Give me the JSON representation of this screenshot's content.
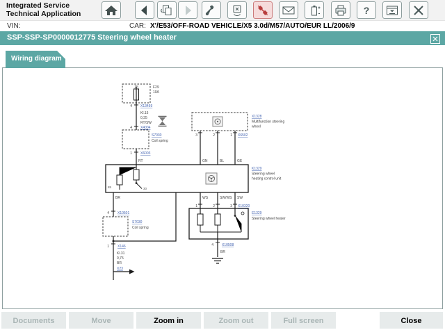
{
  "app": {
    "brand_line1": "Integrated Service",
    "brand_line2": "Technical Application"
  },
  "toolbar": {
    "icons": [
      "home",
      "back",
      "copy-session",
      "forward",
      "wrench",
      "measuring-device",
      "connector-alert",
      "mail",
      "battery",
      "print",
      "help",
      "minimize-tray",
      "close"
    ],
    "help_glyph": "?"
  },
  "vehicle": {
    "vin_label": "VIN:",
    "car_label": "CAR:",
    "car_value": "X'/E53/OFF-ROAD VEHICLE/X5 3.0d/M57/AUTO/EUR LL/2006/9"
  },
  "title_bar": {
    "title": "SSP-SSP-SP0000012775 Steering wheel heater"
  },
  "tabs": {
    "wiring": "Wiring diagram"
  },
  "diagram": {
    "fuse_pin_top": "16",
    "fuse_name": "F29",
    "fuse_rating": "10A",
    "conn1_pin": "4",
    "conn1_link": "X13459",
    "wire1_l1": "Kl.15",
    "wire1_l2": "0,35",
    "wire1_l3": "RT/SW",
    "conn2_pin": "4",
    "conn2_link": "X4004",
    "coil1_link": "S7030",
    "coil1_name": "Coil spring",
    "conn3_pin": "1",
    "conn3_link": "X6003",
    "wire2_color": "RT",
    "mfsw_link": "X1328",
    "mfsw_name1": "Multifunction steering",
    "mfsw_name2": "wheel",
    "mfsw_pin3": "3",
    "mfsw_pin2": "2",
    "mfsw_pin1": "1",
    "conn4_link": "X6502",
    "wire3_color": "GN",
    "wire4_color": "BL",
    "wire5_color": "GE",
    "ctrl_link": "K1329",
    "ctrl_name1": "Steering wheel",
    "ctrl_name2": "heating control unit",
    "ctrl_term_a": "85",
    "ctrl_term_b": "30",
    "wire6_color": "BR",
    "conn5_pin": "4",
    "conn5_link": "X10501",
    "coil2_link": "S7030",
    "coil2_name": "Coil spring",
    "conn6_pin": "1",
    "conn6_link": "X146",
    "wire7_l1": "Kl.31",
    "wire7_l2": "0,75",
    "wire7_l3": "BR",
    "gnd1_link": "X23",
    "wire8_color": "WS",
    "wire9_color": "SW/WS",
    "wire10_color": "SW",
    "conn7_pin1": "1",
    "conn7_pin2": "2",
    "conn7_pin3": "3",
    "conn7_link": "X10320",
    "heater_link": "E1329",
    "heater_name": "Steering wheel heater",
    "conn8_pin": "4",
    "conn8_link": "X10508",
    "wire11_color": "BR"
  },
  "buttons": [
    {
      "label": "Documents",
      "enabled": false
    },
    {
      "label": "Move",
      "enabled": false
    },
    {
      "label": "Zoom in",
      "enabled": true
    },
    {
      "label": "Zoom out",
      "enabled": false
    },
    {
      "label": "Full screen",
      "enabled": false
    },
    {
      "label": "Close",
      "enabled": true
    }
  ]
}
